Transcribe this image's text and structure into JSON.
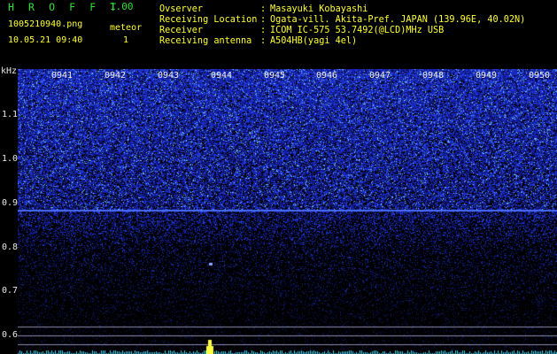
{
  "header": {
    "app_title": "H R O F F T",
    "app_version": "1.00",
    "filename": "1005210940.png",
    "datetime": "10.05.21 09:40",
    "meteor_label": "meteor",
    "meteor_count": "1",
    "info": [
      {
        "key": "Ovserver",
        "value": "Masayuki Kobayashi"
      },
      {
        "key": "Receiving Location",
        "value": "Ogata-vill. Akita-Pref. JAPAN (139.96E, 40.02N)"
      },
      {
        "key": "Receiver",
        "value": "ICOM IC-575 53.7492(@LCD)MHz USB"
      },
      {
        "key": "Receiving antenna",
        "value": "A504HB(yagi 4el)"
      }
    ]
  },
  "spectrogram": {
    "y_unit": "kHz",
    "y_ticks": [
      "1.1",
      "1.0",
      "0.9",
      "0.8",
      "0.7",
      "0.6"
    ],
    "time_labels": [
      "0941",
      "0942",
      "0943",
      "0944",
      "0945",
      "0946",
      "0947",
      "0948",
      "0949",
      "0950"
    ],
    "colors": {
      "background": "#000000",
      "noise": "#2a3cff",
      "carrier_line": "#4a6cff",
      "reference_line": "#8a8ab0",
      "trace": "#40d8f0",
      "peak": "#ffff40"
    }
  }
}
